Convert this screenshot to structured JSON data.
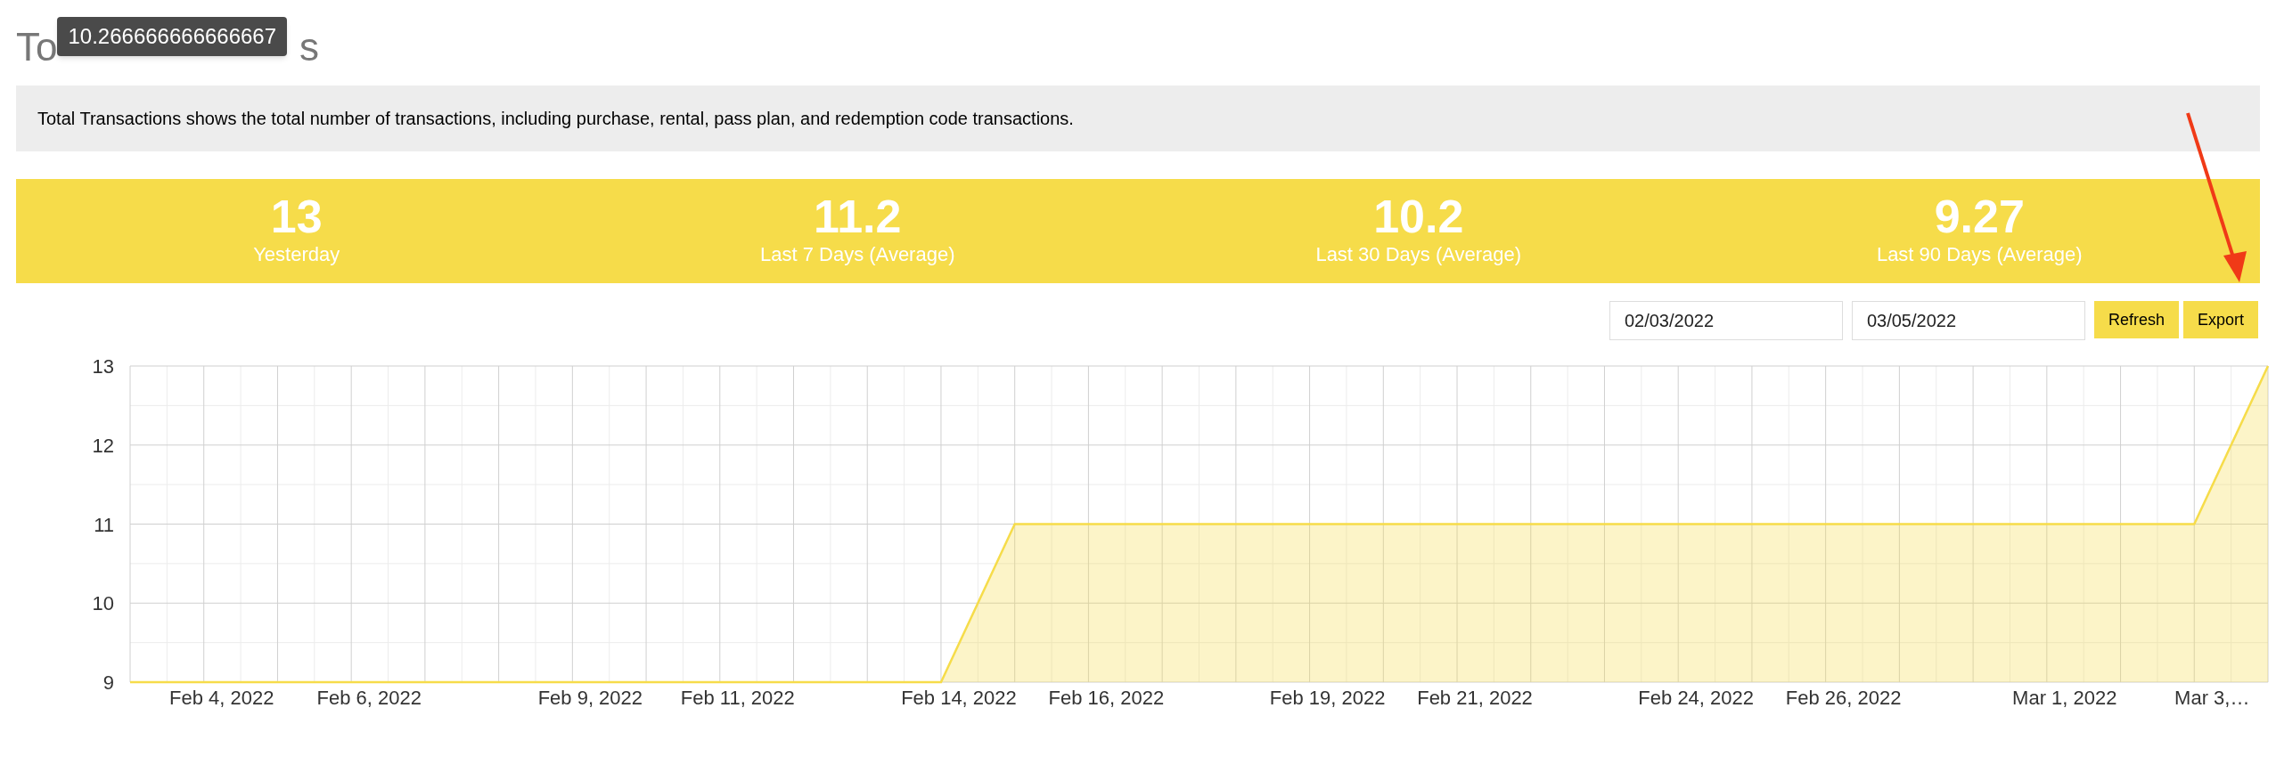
{
  "title_parts": [
    "To",
    "s"
  ],
  "tooltip": "10.266666666666667",
  "description": "Total Transactions shows the total number of transactions, including purchase, rental, pass plan, and redemption code transactions.",
  "stats": [
    {
      "value": "13",
      "label": "Yesterday"
    },
    {
      "value": "11.2",
      "label": "Last 7 Days (Average)"
    },
    {
      "value": "10.2",
      "label": "Last 30 Days (Average)"
    },
    {
      "value": "9.27",
      "label": "Last 90 Days (Average)"
    }
  ],
  "date_from": "02/03/2022",
  "date_to": "03/05/2022",
  "buttons": [
    "Refresh",
    "Export"
  ],
  "chart_data": {
    "type": "area",
    "categories": [
      null,
      "Feb 4, 2022",
      null,
      "Feb 6, 2022",
      null,
      null,
      "Feb 9, 2022",
      null,
      "Feb 11, 2022",
      null,
      null,
      "Feb 14, 2022",
      null,
      "Feb 16, 2022",
      null,
      null,
      "Feb 19, 2022",
      null,
      "Feb 21, 2022",
      null,
      null,
      "Feb 24, 2022",
      null,
      "Feb 26, 2022",
      null,
      null,
      "Mar 1, 2022",
      null,
      "Mar 3,…",
      null
    ],
    "series": [
      {
        "color": "#f6dc4a",
        "values": [
          9,
          9,
          9,
          9,
          9,
          9,
          9,
          9,
          9,
          9,
          9,
          9,
          11,
          11,
          11,
          11,
          11,
          11,
          11,
          11,
          11,
          11,
          11,
          11,
          11,
          11,
          11,
          11,
          11,
          13
        ]
      }
    ],
    "ylim": [
      9,
      13
    ],
    "yticks": [
      9,
      10,
      11,
      12,
      13
    ],
    "grid": true
  }
}
